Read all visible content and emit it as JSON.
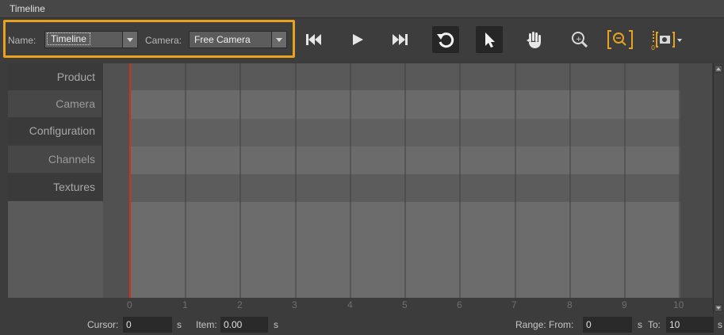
{
  "window": {
    "title": "Timeline"
  },
  "toolbar": {
    "name_label": "Name:",
    "name_value": "Timeline",
    "camera_label": "Camera:",
    "camera_value": "Free Camera",
    "icons": [
      "skip-to-start-icon",
      "play-icon",
      "skip-to-end-icon",
      "loop-icon",
      "select-arrow-icon",
      "pan-hand-icon",
      "zoom-icon",
      "zoom-fit-icon",
      "camera-keyframe-icon",
      "dropdown-icon"
    ],
    "accent_color": "#e8a21e"
  },
  "tracks": [
    "Product",
    "Camera",
    "Configuration",
    "Channels",
    "Textures"
  ],
  "ruler": {
    "ticks": [
      "0",
      "1",
      "2",
      "3",
      "4",
      "5",
      "6",
      "7",
      "8",
      "9",
      "10"
    ],
    "cursor_color": "#d0311f"
  },
  "status": {
    "cursor_label": "Cursor:",
    "cursor_value": "0",
    "cursor_unit": "s",
    "item_label": "Item:",
    "item_value": "0.00",
    "item_unit": "s",
    "range_label": "Range: From:",
    "range_from": "0",
    "range_from_unit": "s",
    "to_label": "To:",
    "range_to": "10",
    "range_to_unit": "s"
  }
}
